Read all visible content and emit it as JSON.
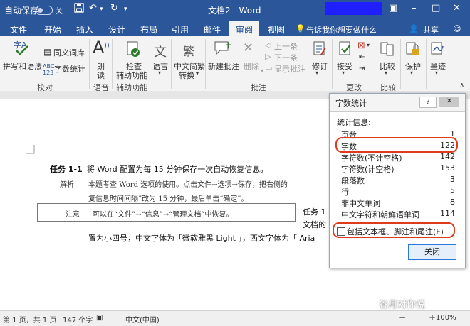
{
  "titlebar": {
    "autosave": "自动保存",
    "autosave_state": "关",
    "title": "文档2 - Word"
  },
  "tabs": [
    "文件",
    "开始",
    "插入",
    "设计",
    "布局",
    "引用",
    "邮件",
    "审阅",
    "视图"
  ],
  "active_tab": "审阅",
  "tell_me": "告诉我你想要做什么",
  "share": "共享",
  "ribbon": {
    "spell": "拼写和语法",
    "thesaurus": "同义词库",
    "wordcount": "字数统计",
    "group_proofing": "校对",
    "read": "朗读",
    "group_speech": "语音",
    "check1": "检查",
    "check2": "辅助功能",
    "group_access": "辅助功能",
    "language": "语言",
    "convert1": "中文简繁",
    "convert2": "转换",
    "newcomment": "新建批注",
    "delete": "删除",
    "prev": "上一条",
    "next": "下一条",
    "show": "显示批注",
    "group_comments": "批注",
    "track": "修订",
    "accept": "接受",
    "group_changes": "更改",
    "compare": "比较",
    "group_compare": "比较",
    "protect": "保护",
    "ink": "墨迹"
  },
  "doc": {
    "task": "任务 1-1",
    "line1": "将 Word 配置为每  15 分钟保存一次自动恢复信息。",
    "label_analysis": "解析",
    "line2": "本题考查 Word 选项的使用。点击文件→选项→保存，把右侧的",
    "line3": "复信息时间间隔”改为 15 分钟，最后单击“确定”。",
    "label_note": "注意",
    "note": "可以在“文件”→“信息”→“管理文档”中恢复。",
    "right1": "任务 1",
    "right2": "文档的",
    "line4": "置为小四号，中文字体为「微软雅黑 Light 」，西文字体为「 Aria"
  },
  "dialog": {
    "title": "字数统计",
    "help": "?",
    "stats_label": "统计信息:",
    "rows": [
      {
        "label": "页数",
        "value": "1"
      },
      {
        "label": "字数",
        "value": "122"
      },
      {
        "label": "字符数(不计空格)",
        "value": "142"
      },
      {
        "label": "字符数(计空格)",
        "value": "153"
      },
      {
        "label": "段落数",
        "value": "3"
      },
      {
        "label": "行",
        "value": "5"
      },
      {
        "label": "非中文单词",
        "value": "8"
      },
      {
        "label": "中文字符和朝鲜语单词",
        "value": "114"
      }
    ],
    "checkbox": "包括文本框、脚注和尾注(F)",
    "close": "关闭"
  },
  "status": {
    "page": "第 1 页，共 1 页",
    "words": "147 个字",
    "lang": "中文(中国)",
    "zoom": "100%"
  },
  "watermark": "谷月对你说",
  "colors": {
    "word_blue": "#2b579a",
    "highlight": "#e03a1c"
  }
}
